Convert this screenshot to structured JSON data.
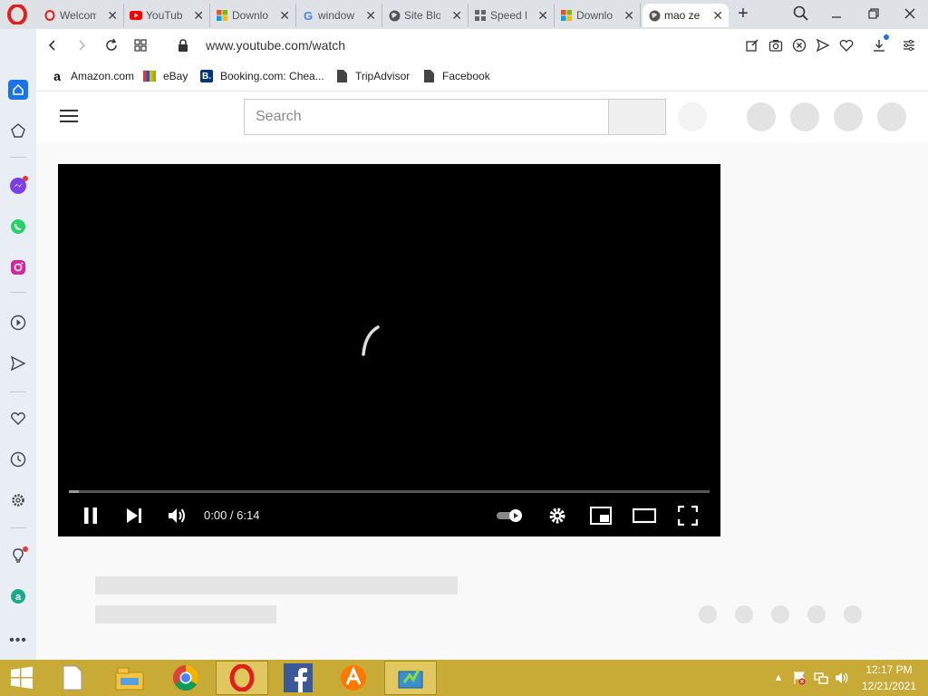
{
  "browser": {
    "tabs": [
      {
        "title": "Welcom",
        "favicon": "opera-icon",
        "active": false
      },
      {
        "title": "YouTub",
        "favicon": "youtube-icon",
        "active": false
      },
      {
        "title": "Downlo",
        "favicon": "microsoft-icon",
        "active": false
      },
      {
        "title": "window",
        "favicon": "google-icon",
        "active": false
      },
      {
        "title": "Site Blo",
        "favicon": "globe-icon",
        "active": false
      },
      {
        "title": "Speed D",
        "favicon": "grid-icon",
        "active": false
      },
      {
        "title": "Downlo",
        "favicon": "microsoft-icon",
        "active": false
      },
      {
        "title": "mao ze",
        "favicon": "globe-icon",
        "active": true
      }
    ],
    "url": "www.youtube.com/watch",
    "bookmarks": [
      {
        "label": "Amazon.com",
        "icon": "amazon-icon"
      },
      {
        "label": "eBay",
        "icon": "ebay-icon"
      },
      {
        "label": "Booking.com: Chea...",
        "icon": "booking-icon"
      },
      {
        "label": "TripAdvisor",
        "icon": "page-icon"
      },
      {
        "label": "Facebook",
        "icon": "page-icon"
      }
    ]
  },
  "youtube": {
    "search_placeholder": "Search",
    "player": {
      "time_display": "0:00 / 6:14",
      "progress_loaded": 0.015,
      "state": "loading"
    }
  },
  "taskbar": {
    "time": "12:17 PM",
    "date": "12/21/2021",
    "apps": [
      "start-icon",
      "file-icon",
      "file-explorer-icon",
      "chrome-icon",
      "opera-icon",
      "facebook-icon",
      "avast-icon",
      "network-monitor-icon"
    ]
  },
  "colors": {
    "opera_red": "#e0201b",
    "taskbar": "#c8aa36",
    "sidebar": "#e9eef5",
    "youtube_red": "#ff0000"
  }
}
